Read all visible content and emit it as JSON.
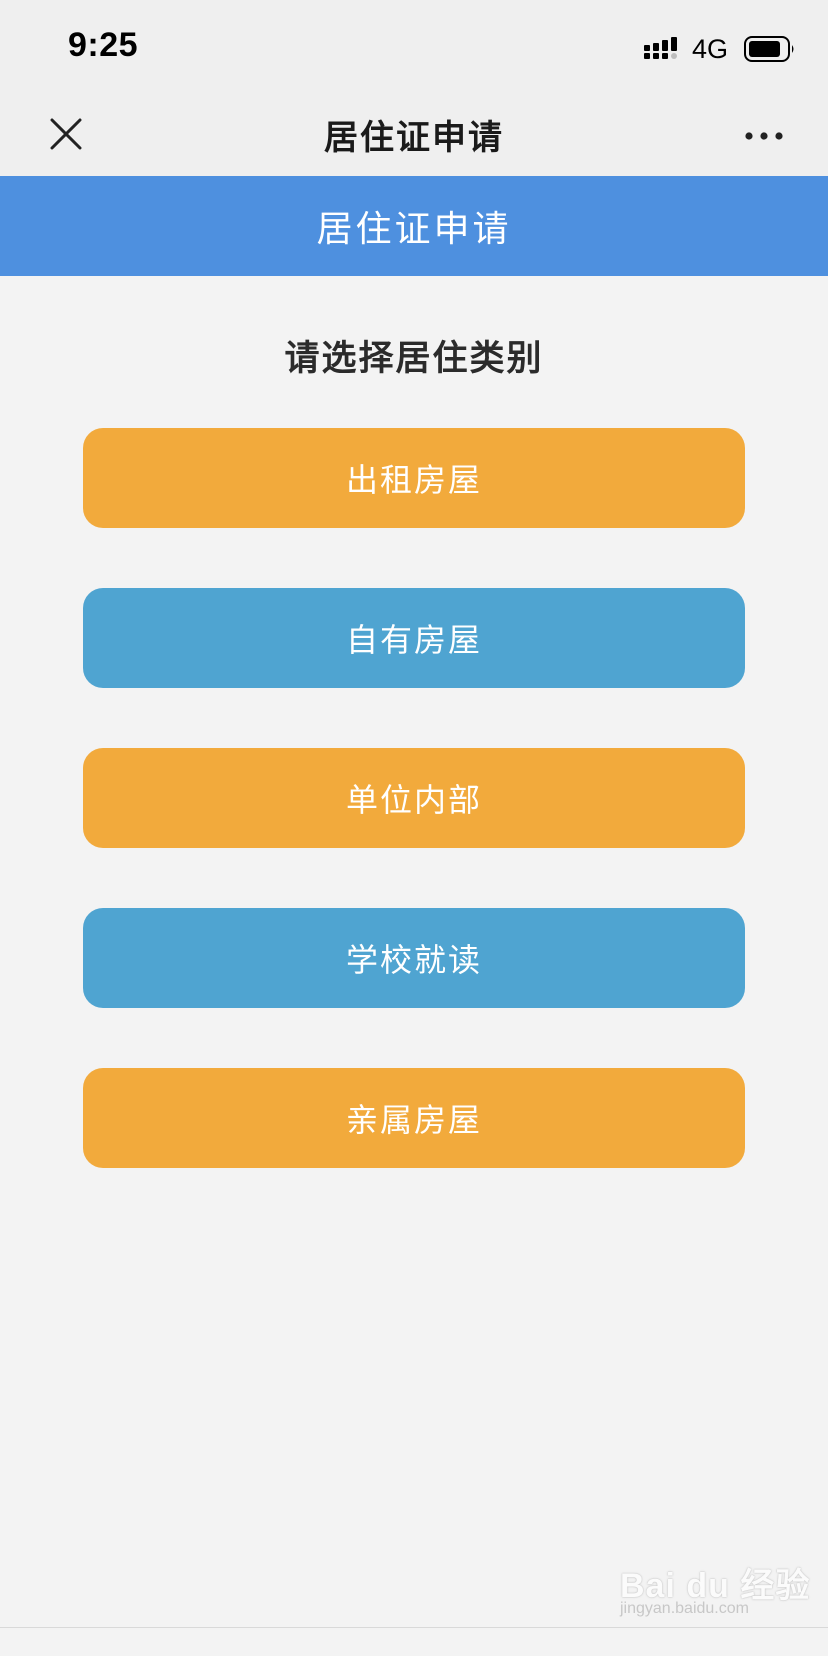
{
  "status_bar": {
    "time": "9:25",
    "network": "4G",
    "icons": [
      "signal-icon",
      "battery-icon"
    ]
  },
  "nav": {
    "title": "居住证申请",
    "icons": [
      "close-icon",
      "more-icon"
    ]
  },
  "banner": {
    "title": "居住证申请",
    "color": "#4e90df"
  },
  "content": {
    "section_title": "请选择居住类别",
    "options": [
      {
        "label": "出租房屋",
        "color": "#f2aa3c"
      },
      {
        "label": "自有房屋",
        "color": "#4fa4d1"
      },
      {
        "label": "单位内部",
        "color": "#f2aa3c"
      },
      {
        "label": "学校就读",
        "color": "#4fa4d1"
      },
      {
        "label": "亲属房屋",
        "color": "#f2aa3c"
      }
    ]
  },
  "watermark": {
    "text": "Bai du 经验",
    "sub": "jingyan.baidu.com"
  }
}
